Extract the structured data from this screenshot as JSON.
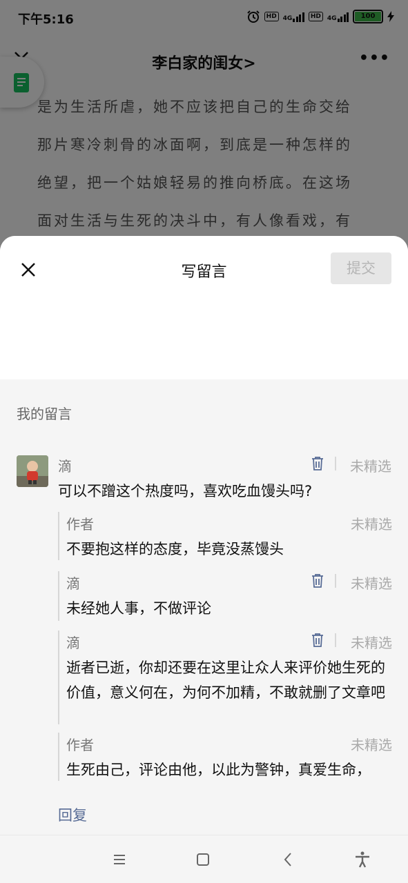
{
  "status_bar": {
    "time": "下午5:16",
    "hd1": "HD",
    "net1": "4G",
    "hd2": "HD",
    "net2": "4G",
    "battery": "100"
  },
  "article": {
    "title": "李白家的闺女",
    "title_chevron": ">",
    "more": "•••",
    "lines": [
      "是为生活所虐，她不应该把自己的生命交给",
      "那片寒冷刺骨的冰面啊，到底是一种怎样的",
      "绝望，把一个姑娘轻易的推向桥底。在这场",
      "面对生活与生死的决斗中，有人像看戏，有"
    ]
  },
  "sheet": {
    "title": "写留言",
    "submit_label": "提交",
    "section_label": "我的留言"
  },
  "comment": {
    "nickname": "滴",
    "text": "可以不蹭这个热度吗，喜欢吃血馒头吗?",
    "status": "未精选",
    "replies": [
      {
        "nickname": "作者",
        "text": "不要抱这样的态度，毕竟没蒸馒头",
        "status": "未精选"
      },
      {
        "nickname": "滴",
        "text": "未经她人事，不做评论",
        "status": "未精选"
      },
      {
        "nickname": "滴",
        "text": "逝者已逝，你却还要在这里让众人来评价她生死的价值，意义何在，为何不加精，不敢就删了文章吧",
        "status": "未精选"
      },
      {
        "nickname": "作者",
        "text": "生死由己，评论由他，以此为警钟，真爱生命，",
        "status": "未精选"
      }
    ],
    "reply_link": "回复"
  },
  "icons": {
    "close": "close-icon",
    "trash": "trash-icon",
    "menu": "menu-icon",
    "home": "home-square-icon",
    "back": "back-chevron-icon",
    "accessibility": "accessibility-icon",
    "doc": "document-icon"
  },
  "colors": {
    "accent_link": "#576b95",
    "doc_green": "#17c05f",
    "battery_green": "#3fb94a"
  }
}
